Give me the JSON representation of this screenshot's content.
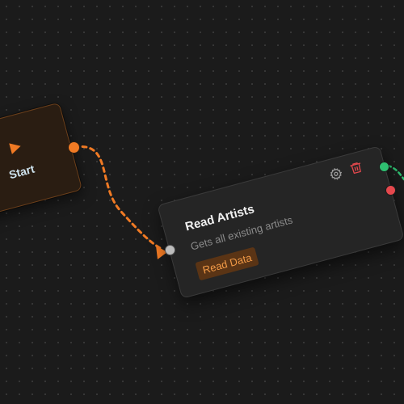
{
  "nodes": {
    "start": {
      "label": "Start",
      "icon": "play-icon"
    },
    "read_artists": {
      "title": "Read Artists",
      "description": "Gets all existing artists",
      "badge": "Read Data",
      "actions": [
        {
          "icon": "gear-icon"
        },
        {
          "icon": "trash-icon"
        }
      ]
    }
  },
  "colors": {
    "canvas_background": "#1b1b1b",
    "accent": "#f07a24",
    "start_node_background": "#2a1d12",
    "task_node_background": "#252525",
    "success_handle": "#2fbf71",
    "error_handle": "#e5484d",
    "input_handle": "#bdbdbd",
    "delete_icon": "#e5484d",
    "badge_text": "#f29a47",
    "badge_background": "#5a3415"
  }
}
